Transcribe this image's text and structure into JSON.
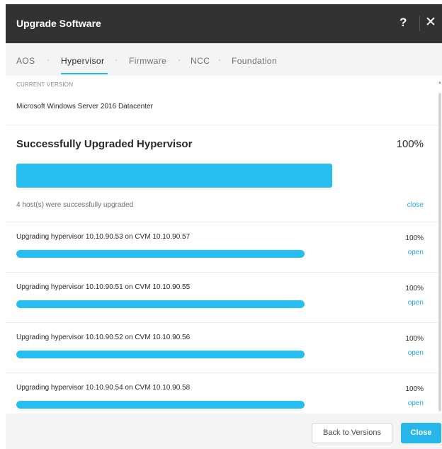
{
  "header": {
    "title": "Upgrade Software",
    "help_label": "?",
    "close_label": "✕"
  },
  "tabs": {
    "items": [
      {
        "label": "AOS"
      },
      {
        "label": "Hypervisor"
      },
      {
        "label": "Firmware"
      },
      {
        "label": "NCC"
      },
      {
        "label": "Foundation"
      }
    ],
    "separator": "·",
    "active": "Hypervisor"
  },
  "current_version": {
    "label": "CURRENT VERSION",
    "value": "Microsoft Windows Server 2016 Datacenter"
  },
  "summary": {
    "title": "Successfully Upgraded Hypervisor",
    "percent": "100%",
    "progress": 1.0,
    "message": "4 host(s) were successfully upgraded",
    "close_label": "close"
  },
  "hosts": [
    {
      "label": "Upgrading hypervisor 10.10.90.53 on CVM 10.10.90.57",
      "percent": "100%",
      "progress": 1.0,
      "open_label": "open"
    },
    {
      "label": "Upgrading hypervisor 10.10.90.51 on CVM 10.10.90.55",
      "percent": "100%",
      "progress": 1.0,
      "open_label": "open"
    },
    {
      "label": "Upgrading hypervisor 10.10.90.52 on CVM 10.10.90.56",
      "percent": "100%",
      "progress": 1.0,
      "open_label": "open"
    },
    {
      "label": "Upgrading hypervisor 10.10.90.54 on CVM 10.10.90.58",
      "percent": "100%",
      "progress": 1.0,
      "open_label": "open"
    }
  ],
  "footer": {
    "back_label": "Back to Versions",
    "close_label": "Close"
  },
  "colors": {
    "accent": "#26b6ec",
    "progress": "#26bdf0",
    "titlebar": "#323232",
    "link": "#26a6e0"
  }
}
